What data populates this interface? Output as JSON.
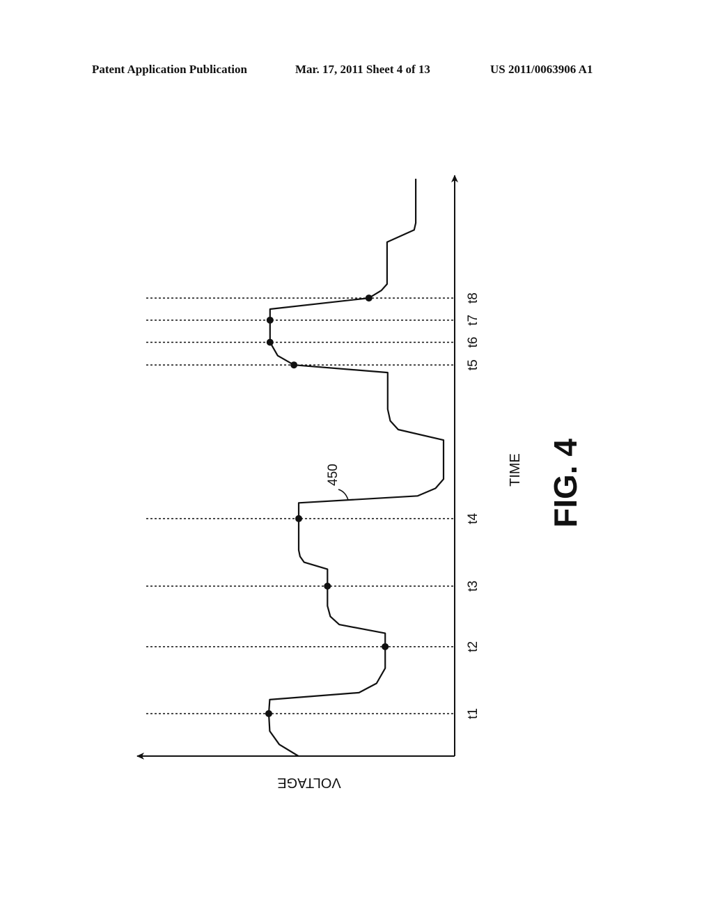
{
  "header": {
    "publication": "Patent Application Publication",
    "date_sheet": "Mar. 17, 2011  Sheet 4 of 13",
    "patent_number": "US 2011/0063906 A1"
  },
  "chart_data": {
    "type": "line",
    "title": "FIG. 4",
    "orientation": "rotated-90",
    "xlabel": "TIME",
    "ylabel": "VOLTAGE",
    "xlim": [
      0,
      100
    ],
    "ylim": [
      0,
      100
    ],
    "grid": false,
    "reference_label": "450",
    "markers": [
      {
        "label": "t1",
        "time": 7.3,
        "voltage": 58.3
      },
      {
        "label": "t2",
        "time": 18.8,
        "voltage": 21.8
      },
      {
        "label": "t3",
        "time": 29.2,
        "voltage": 39.9
      },
      {
        "label": "t4",
        "time": 40.8,
        "voltage": 48.9
      },
      {
        "label": "t5",
        "time": 67.2,
        "voltage": 50.4
      },
      {
        "label": "t6",
        "time": 71.1,
        "voltage": 57.9
      },
      {
        "label": "t7",
        "time": 74.9,
        "voltage": 57.9
      },
      {
        "label": "t8",
        "time": 78.7,
        "voltage": 26.9
      }
    ],
    "series": [
      {
        "name": "450",
        "points": [
          [
            0,
            49
          ],
          [
            2,
            55
          ],
          [
            4.3,
            58
          ],
          [
            7.3,
            58.3
          ],
          [
            9.7,
            58
          ],
          [
            10.9,
            30
          ],
          [
            12.5,
            24.5
          ],
          [
            15.1,
            21.8
          ],
          [
            18.8,
            21.8
          ],
          [
            21.1,
            21.8
          ],
          [
            22.6,
            36.2
          ],
          [
            24,
            39
          ],
          [
            25.8,
            39.9
          ],
          [
            29.2,
            39.9
          ],
          [
            32.1,
            39.9
          ],
          [
            33.3,
            47.2
          ],
          [
            34.3,
            48.5
          ],
          [
            35.4,
            48.9
          ],
          [
            40.8,
            48.9
          ],
          [
            43.5,
            48.9
          ],
          [
            44.7,
            11.6
          ],
          [
            46,
            6
          ],
          [
            47.6,
            3.5
          ],
          [
            54.3,
            3.5
          ],
          [
            56.1,
            17.7
          ],
          [
            57.6,
            20.2
          ],
          [
            59.6,
            21
          ],
          [
            65.9,
            21
          ],
          [
            67.2,
            50.4
          ],
          [
            68.8,
            55.5
          ],
          [
            71.1,
            57.9
          ],
          [
            74.9,
            57.9
          ],
          [
            76.8,
            57.9
          ],
          [
            78.7,
            26.9
          ],
          [
            80,
            23
          ],
          [
            81.1,
            21.2
          ],
          [
            88.3,
            21.2
          ],
          [
            90.4,
            12.7
          ],
          [
            91.6,
            12.2
          ],
          [
            99.2,
            12.2
          ]
        ]
      }
    ]
  }
}
